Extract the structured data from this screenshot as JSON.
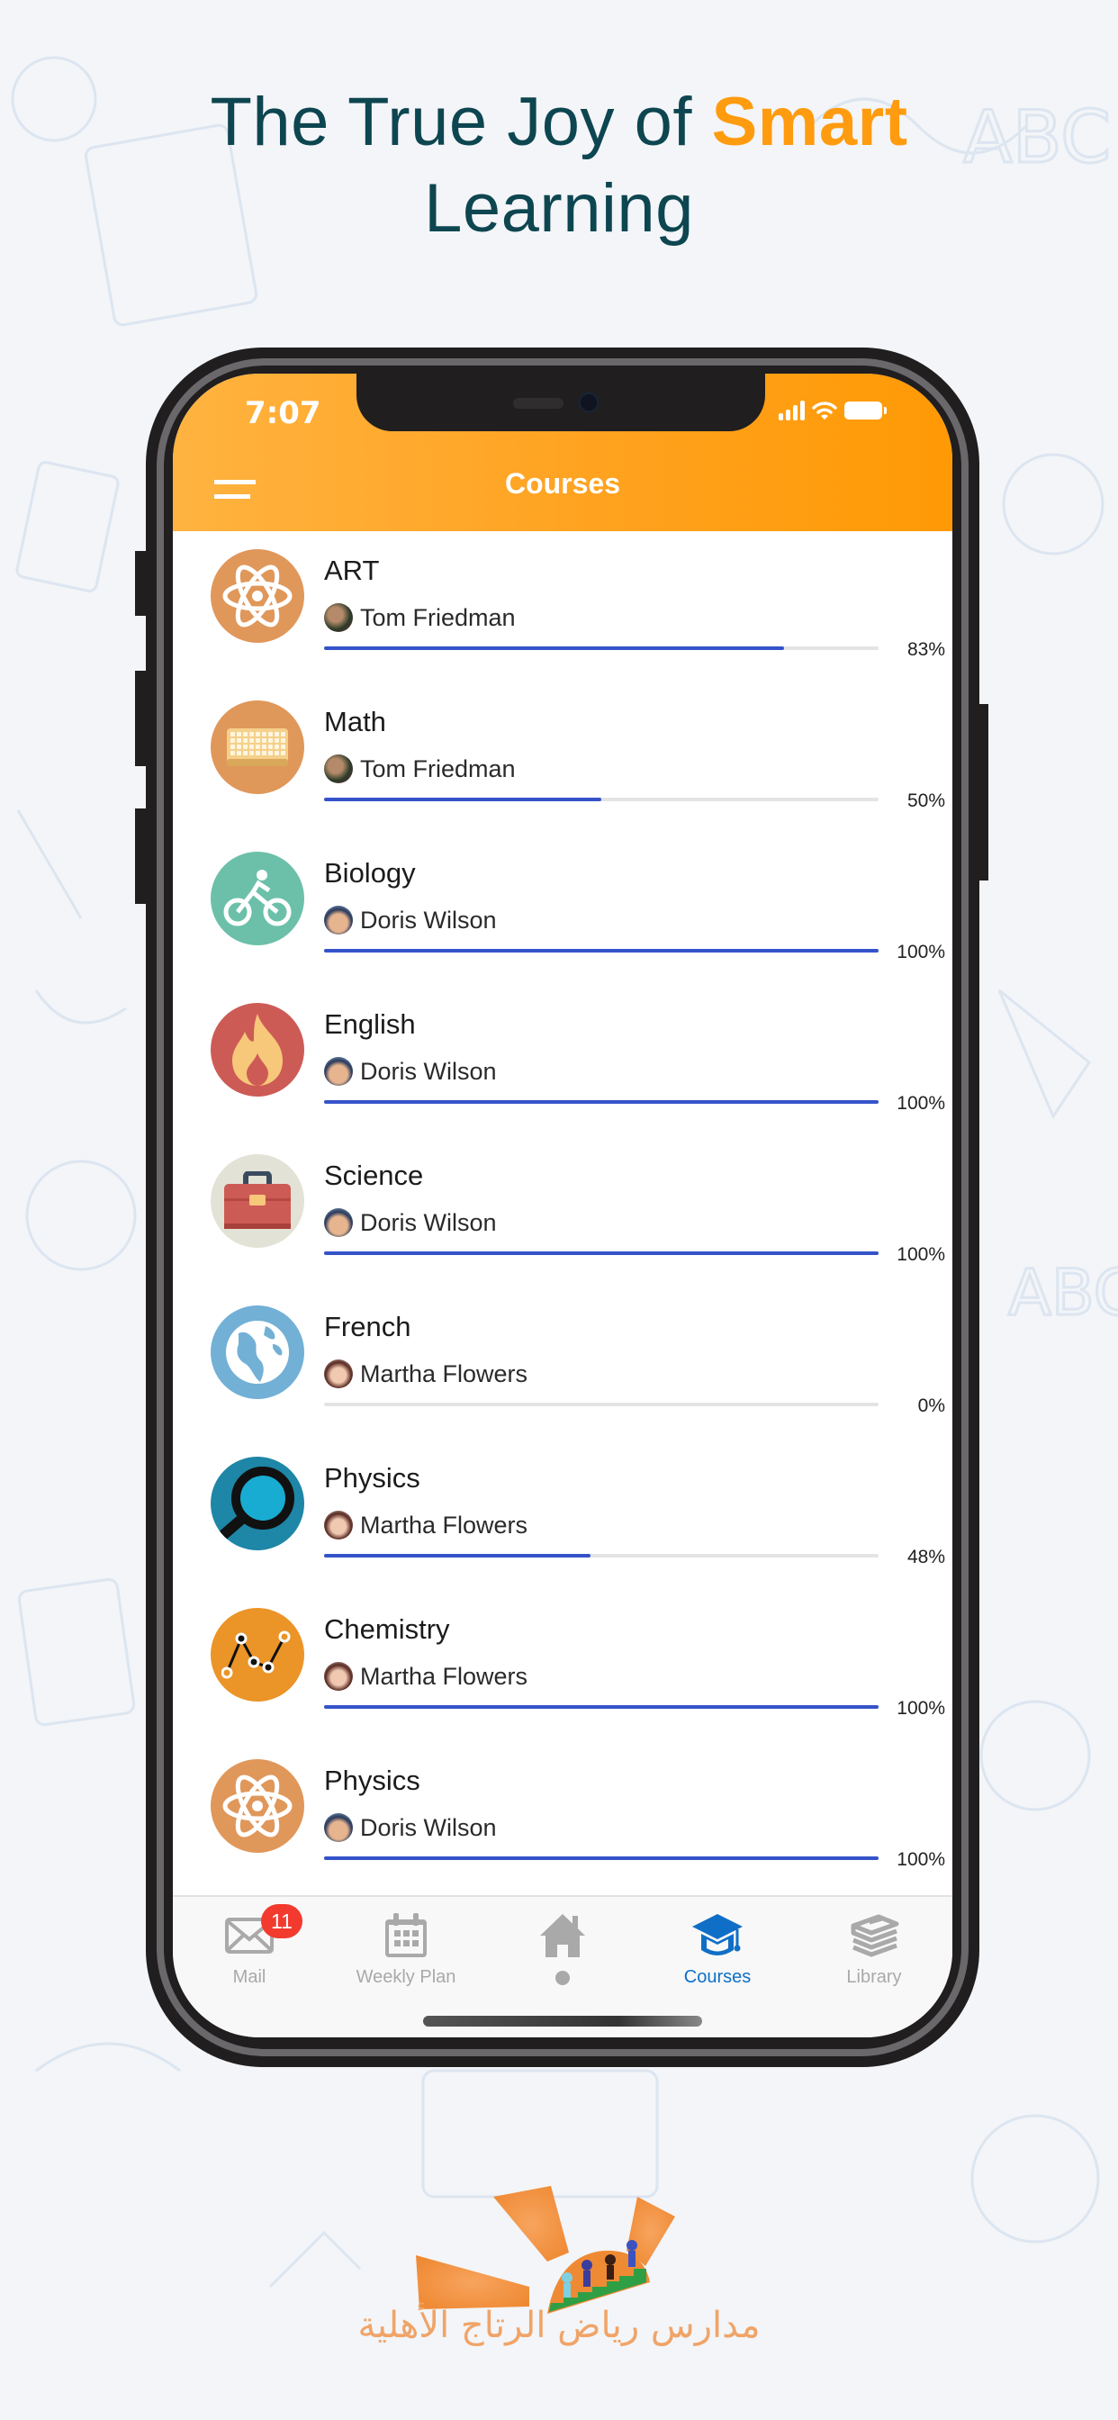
{
  "headline": {
    "prefix": "The True Joy of",
    "accent": "Smart",
    "suffix": "Learning",
    "colors": {
      "text": "#0d4650",
      "accent": "#ff9b0f"
    }
  },
  "status_bar": {
    "time": "7:07",
    "icons": [
      "cellular-signal-icon",
      "wifi-icon",
      "battery-icon"
    ]
  },
  "app_header": {
    "title": "Courses",
    "menu_icon": "hamburger-menu-icon",
    "color": "#ffa21f"
  },
  "courses": [
    {
      "name": "ART",
      "teacher": "Tom Friedman",
      "progress": 83,
      "progress_label": "83%",
      "icon": "atom-icon",
      "icon_bg": "#e0975a"
    },
    {
      "name": "Math",
      "teacher": "Tom Friedman",
      "progress": 50,
      "progress_label": "50%",
      "icon": "keyboard-icon",
      "icon_bg": "#e0975a"
    },
    {
      "name": "Biology",
      "teacher": "Doris Wilson",
      "progress": 100,
      "progress_label": "100%",
      "icon": "cyclist-icon",
      "icon_bg": "#6cc0a9"
    },
    {
      "name": "English",
      "teacher": "Doris Wilson",
      "progress": 100,
      "progress_label": "100%",
      "icon": "flame-icon",
      "icon_bg": "#cd5b55"
    },
    {
      "name": "Science",
      "teacher": "Doris Wilson",
      "progress": 100,
      "progress_label": "100%",
      "icon": "toolbox-icon",
      "icon_bg": "#e3e2d6"
    },
    {
      "name": "French",
      "teacher": "Martha Flowers",
      "progress": 0,
      "progress_label": "0%",
      "icon": "globe-icon",
      "icon_bg": "#72b0d6"
    },
    {
      "name": "Physics",
      "teacher": "Martha Flowers",
      "progress": 48,
      "progress_label": "48%",
      "icon": "magnifier-icon",
      "icon_bg": "#1e86a6"
    },
    {
      "name": "Chemistry",
      "teacher": "Martha Flowers",
      "progress": 100,
      "progress_label": "100%",
      "icon": "line-graph-icon",
      "icon_bg": "#eb9428"
    },
    {
      "name": "Physics",
      "teacher": "Doris Wilson",
      "progress": 100,
      "progress_label": "100%",
      "icon": "atom-icon",
      "icon_bg": "#e0975a"
    }
  ],
  "progress_colors": {
    "fill": "#3553c9",
    "track": "#e4e4e4"
  },
  "tabbar": {
    "active": "Courses",
    "tabs": [
      {
        "label": "Mail",
        "icon": "mail-icon",
        "badge": "11"
      },
      {
        "label": "Weekly Plan",
        "icon": "calendar-icon"
      },
      {
        "label": "",
        "icon": "home-icon"
      },
      {
        "label": "Courses",
        "icon": "graduation-cap-icon"
      },
      {
        "label": "Library",
        "icon": "books-icon"
      }
    ],
    "active_color": "#0f6fc6",
    "inactive_color": "#a9a9a9",
    "badge_color": "#f23a2e"
  },
  "logo": {
    "text": "مدارس رياض الرتاج الأهلية",
    "color": "#f0a468"
  }
}
